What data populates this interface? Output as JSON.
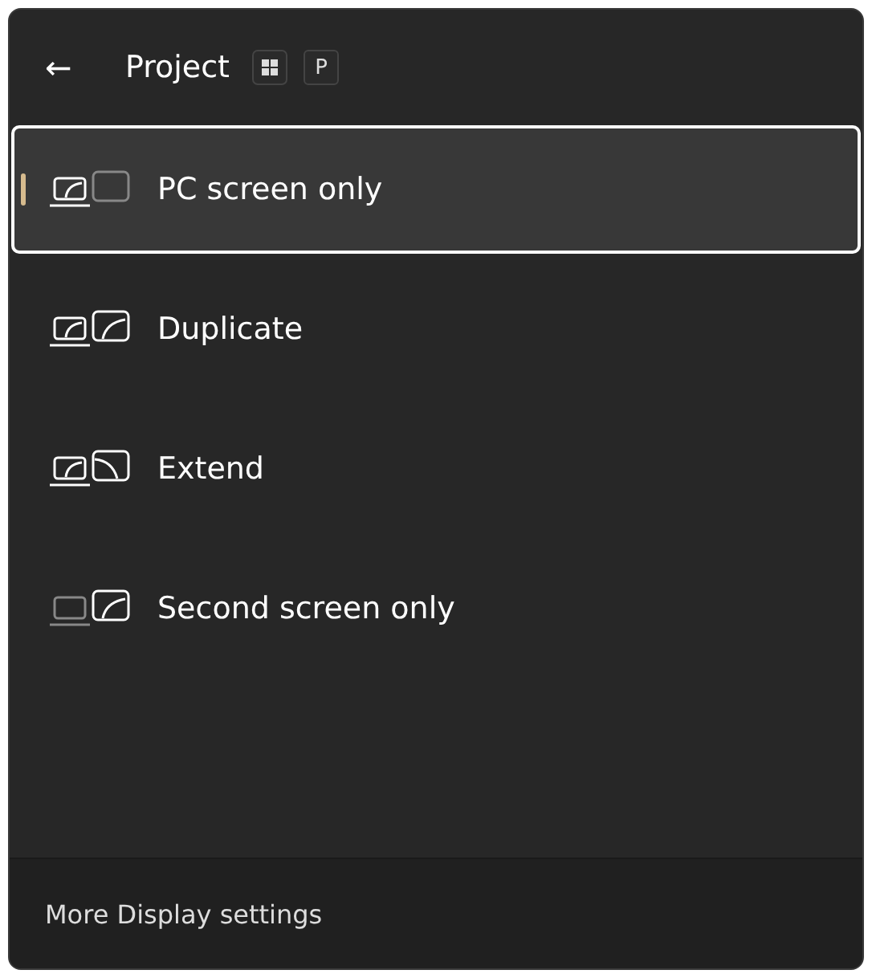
{
  "header": {
    "back": "←",
    "title": "Project",
    "shortcut_key": "P"
  },
  "options": [
    {
      "kind": "pc-only",
      "label": "PC screen only",
      "selected": true
    },
    {
      "kind": "duplicate",
      "label": "Duplicate",
      "selected": false
    },
    {
      "kind": "extend",
      "label": "Extend",
      "selected": false
    },
    {
      "kind": "second-only",
      "label": "Second screen only",
      "selected": false
    }
  ],
  "footer": {
    "link": "More Display settings"
  }
}
